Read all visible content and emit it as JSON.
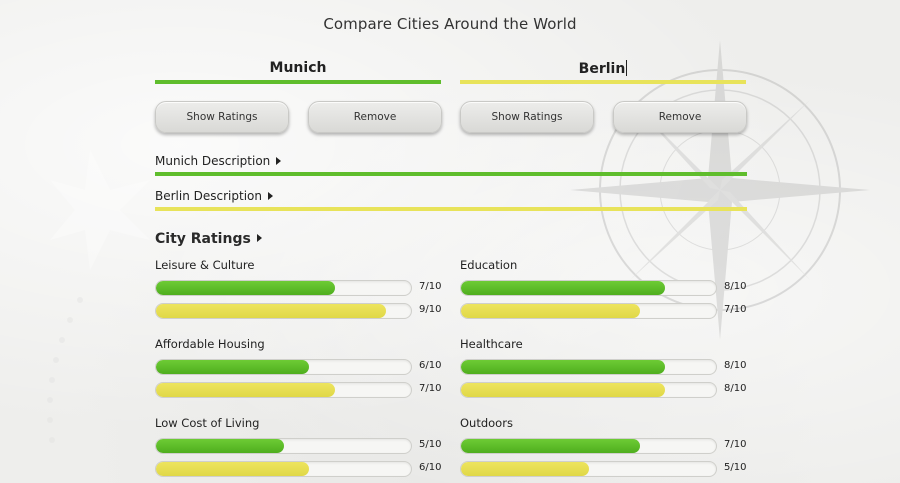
{
  "header": {
    "title": "Compare Cities Around the World"
  },
  "cities": [
    {
      "name": "Munich",
      "show_ratings_label": "Show Ratings",
      "remove_label": "Remove",
      "color": "#5fbd2c"
    },
    {
      "name": "Berlin",
      "show_ratings_label": "Show Ratings",
      "remove_label": "Remove",
      "color": "#e8e35a"
    }
  ],
  "descriptions": {
    "munich": "Munich Description",
    "berlin": "Berlin Description"
  },
  "ratings": {
    "title": "City Ratings",
    "categories": [
      {
        "name": "Leisure & Culture",
        "munich": "7/10",
        "munich_value": 7,
        "berlin": "9/10",
        "berlin_value": 9
      },
      {
        "name": "Education",
        "munich": "8/10",
        "munich_value": 8,
        "berlin": "7/10",
        "berlin_value": 7
      },
      {
        "name": "Affordable Housing",
        "munich": "6/10",
        "munich_value": 6,
        "berlin": "7/10",
        "berlin_value": 7
      },
      {
        "name": "Healthcare",
        "munich": "8/10",
        "munich_value": 8,
        "berlin": "8/10",
        "berlin_value": 8
      },
      {
        "name": "Low Cost of Living",
        "munich": "5/10",
        "munich_value": 5,
        "berlin": "6/10",
        "berlin_value": 6
      },
      {
        "name": "Outdoors",
        "munich": "7/10",
        "munich_value": 7,
        "berlin": "5/10",
        "berlin_value": 5
      }
    ]
  },
  "colors": {
    "munich": "#5fbd2c",
    "berlin": "#e8e35a"
  }
}
